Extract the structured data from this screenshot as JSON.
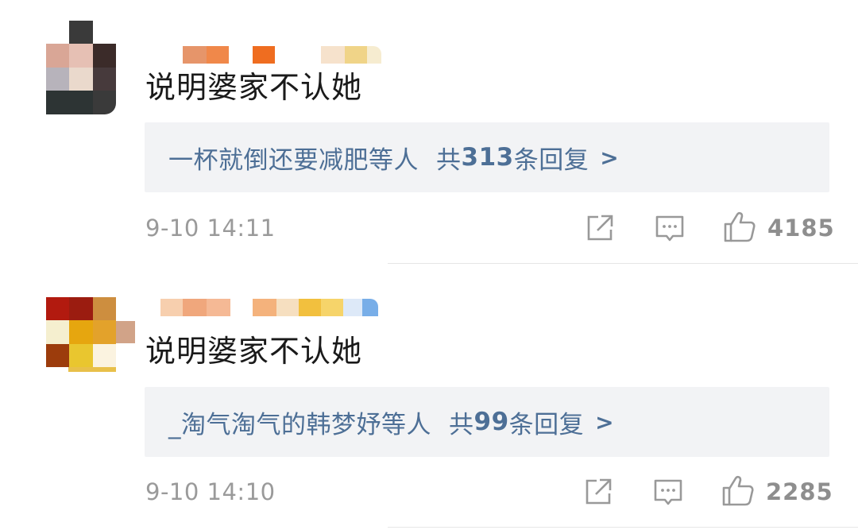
{
  "comments": [
    {
      "text": "说明婆家不认她",
      "replies": {
        "names": "一杯就倒还要减肥等人",
        "prefix": "共",
        "count": "313",
        "suffix": "条回复",
        "arrow": ">"
      },
      "timestamp": "9-10 14:11",
      "likes": "4185"
    },
    {
      "text": "说明婆家不认她",
      "replies": {
        "names": "_淘气淘气的韩梦妤等人",
        "prefix": "共",
        "count": "99",
        "suffix": "条回复",
        "arrow": ">"
      },
      "timestamp": "9-10 14:10",
      "likes": "2285"
    }
  ],
  "colors": {
    "reply_link": "#4d6f96",
    "reply_bg": "#f2f3f5",
    "meta_gray": "#9a9a9a",
    "text": "#1a1a1a"
  },
  "icons": [
    "share-icon",
    "comment-icon",
    "thumbs-up-icon"
  ]
}
